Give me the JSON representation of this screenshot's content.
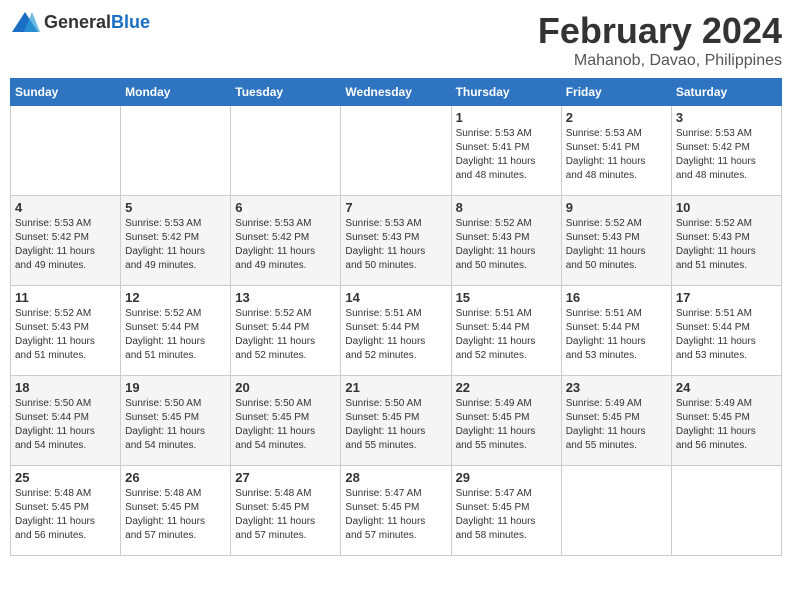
{
  "logo": {
    "general": "General",
    "blue": "Blue"
  },
  "title": "February 2024",
  "location": "Mahanob, Davao, Philippines",
  "weekdays": [
    "Sunday",
    "Monday",
    "Tuesday",
    "Wednesday",
    "Thursday",
    "Friday",
    "Saturday"
  ],
  "weeks": [
    [
      {
        "day": "",
        "info": ""
      },
      {
        "day": "",
        "info": ""
      },
      {
        "day": "",
        "info": ""
      },
      {
        "day": "",
        "info": ""
      },
      {
        "day": "1",
        "info": "Sunrise: 5:53 AM\nSunset: 5:41 PM\nDaylight: 11 hours\nand 48 minutes."
      },
      {
        "day": "2",
        "info": "Sunrise: 5:53 AM\nSunset: 5:41 PM\nDaylight: 11 hours\nand 48 minutes."
      },
      {
        "day": "3",
        "info": "Sunrise: 5:53 AM\nSunset: 5:42 PM\nDaylight: 11 hours\nand 48 minutes."
      }
    ],
    [
      {
        "day": "4",
        "info": "Sunrise: 5:53 AM\nSunset: 5:42 PM\nDaylight: 11 hours\nand 49 minutes."
      },
      {
        "day": "5",
        "info": "Sunrise: 5:53 AM\nSunset: 5:42 PM\nDaylight: 11 hours\nand 49 minutes."
      },
      {
        "day": "6",
        "info": "Sunrise: 5:53 AM\nSunset: 5:42 PM\nDaylight: 11 hours\nand 49 minutes."
      },
      {
        "day": "7",
        "info": "Sunrise: 5:53 AM\nSunset: 5:43 PM\nDaylight: 11 hours\nand 50 minutes."
      },
      {
        "day": "8",
        "info": "Sunrise: 5:52 AM\nSunset: 5:43 PM\nDaylight: 11 hours\nand 50 minutes."
      },
      {
        "day": "9",
        "info": "Sunrise: 5:52 AM\nSunset: 5:43 PM\nDaylight: 11 hours\nand 50 minutes."
      },
      {
        "day": "10",
        "info": "Sunrise: 5:52 AM\nSunset: 5:43 PM\nDaylight: 11 hours\nand 51 minutes."
      }
    ],
    [
      {
        "day": "11",
        "info": "Sunrise: 5:52 AM\nSunset: 5:43 PM\nDaylight: 11 hours\nand 51 minutes."
      },
      {
        "day": "12",
        "info": "Sunrise: 5:52 AM\nSunset: 5:44 PM\nDaylight: 11 hours\nand 51 minutes."
      },
      {
        "day": "13",
        "info": "Sunrise: 5:52 AM\nSunset: 5:44 PM\nDaylight: 11 hours\nand 52 minutes."
      },
      {
        "day": "14",
        "info": "Sunrise: 5:51 AM\nSunset: 5:44 PM\nDaylight: 11 hours\nand 52 minutes."
      },
      {
        "day": "15",
        "info": "Sunrise: 5:51 AM\nSunset: 5:44 PM\nDaylight: 11 hours\nand 52 minutes."
      },
      {
        "day": "16",
        "info": "Sunrise: 5:51 AM\nSunset: 5:44 PM\nDaylight: 11 hours\nand 53 minutes."
      },
      {
        "day": "17",
        "info": "Sunrise: 5:51 AM\nSunset: 5:44 PM\nDaylight: 11 hours\nand 53 minutes."
      }
    ],
    [
      {
        "day": "18",
        "info": "Sunrise: 5:50 AM\nSunset: 5:44 PM\nDaylight: 11 hours\nand 54 minutes."
      },
      {
        "day": "19",
        "info": "Sunrise: 5:50 AM\nSunset: 5:45 PM\nDaylight: 11 hours\nand 54 minutes."
      },
      {
        "day": "20",
        "info": "Sunrise: 5:50 AM\nSunset: 5:45 PM\nDaylight: 11 hours\nand 54 minutes."
      },
      {
        "day": "21",
        "info": "Sunrise: 5:50 AM\nSunset: 5:45 PM\nDaylight: 11 hours\nand 55 minutes."
      },
      {
        "day": "22",
        "info": "Sunrise: 5:49 AM\nSunset: 5:45 PM\nDaylight: 11 hours\nand 55 minutes."
      },
      {
        "day": "23",
        "info": "Sunrise: 5:49 AM\nSunset: 5:45 PM\nDaylight: 11 hours\nand 55 minutes."
      },
      {
        "day": "24",
        "info": "Sunrise: 5:49 AM\nSunset: 5:45 PM\nDaylight: 11 hours\nand 56 minutes."
      }
    ],
    [
      {
        "day": "25",
        "info": "Sunrise: 5:48 AM\nSunset: 5:45 PM\nDaylight: 11 hours\nand 56 minutes."
      },
      {
        "day": "26",
        "info": "Sunrise: 5:48 AM\nSunset: 5:45 PM\nDaylight: 11 hours\nand 57 minutes."
      },
      {
        "day": "27",
        "info": "Sunrise: 5:48 AM\nSunset: 5:45 PM\nDaylight: 11 hours\nand 57 minutes."
      },
      {
        "day": "28",
        "info": "Sunrise: 5:47 AM\nSunset: 5:45 PM\nDaylight: 11 hours\nand 57 minutes."
      },
      {
        "day": "29",
        "info": "Sunrise: 5:47 AM\nSunset: 5:45 PM\nDaylight: 11 hours\nand 58 minutes."
      },
      {
        "day": "",
        "info": ""
      },
      {
        "day": "",
        "info": ""
      }
    ]
  ]
}
